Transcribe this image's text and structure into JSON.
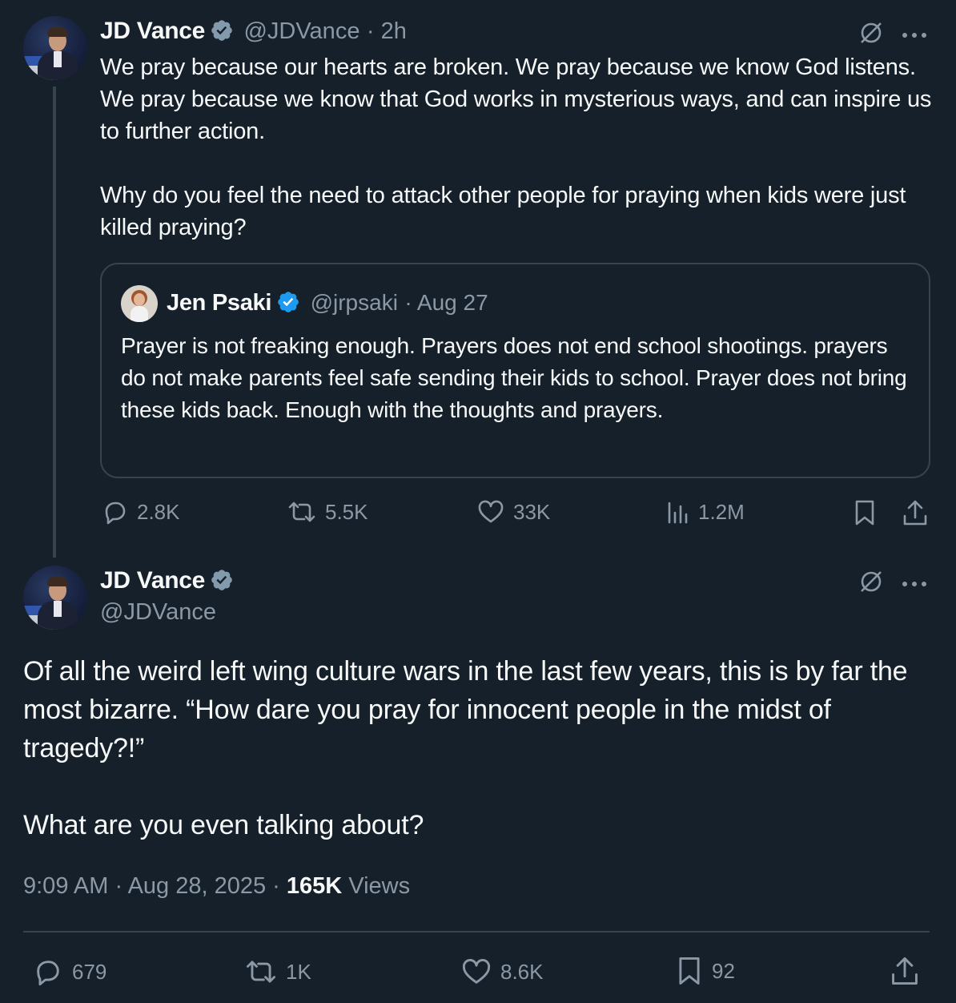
{
  "tweet1": {
    "author_name": "JD Vance",
    "handle": "@JDVance",
    "time": "· 2h",
    "text_p1": "We pray because our hearts are broken. We pray because we know God listens. We pray because we know that God works in mysterious ways, and can inspire us to further action.",
    "text_p2": "Why do you feel the need to attack other people for praying when kids were just killed praying?",
    "quote": {
      "author_name": "Jen Psaki",
      "handle": "@jrpsaki",
      "date": "· Aug 27",
      "text": "Prayer is not freaking enough.  Prayers does not end school shootings. prayers do not make parents feel safe sending their kids to school. Prayer does not bring these kids back. Enough with the thoughts and prayers."
    },
    "actions": {
      "replies": "2.8K",
      "reposts": "5.5K",
      "likes": "33K",
      "views": "1.2M"
    }
  },
  "tweet2": {
    "author_name": "JD Vance",
    "handle": "@JDVance",
    "text_p1": "Of all the weird left wing culture wars in the last few years, this is by far the most bizarre. “How dare you pray for innocent people in the midst of tragedy?!”",
    "text_p2": "What are you even talking about?",
    "timestamp": "9:09 AM · Aug 28, 2025 · ",
    "views_count": "165K",
    "views_label": " Views",
    "actions": {
      "replies": "679",
      "reposts": "1K",
      "likes": "8.6K",
      "bookmarks": "92"
    }
  },
  "colors": {
    "background": "#15202b",
    "text": "#f7f9f9",
    "muted": "#8b98a5",
    "border": "#38444d",
    "verified_gray": "#829aab",
    "verified_blue": "#1d9bf0"
  }
}
